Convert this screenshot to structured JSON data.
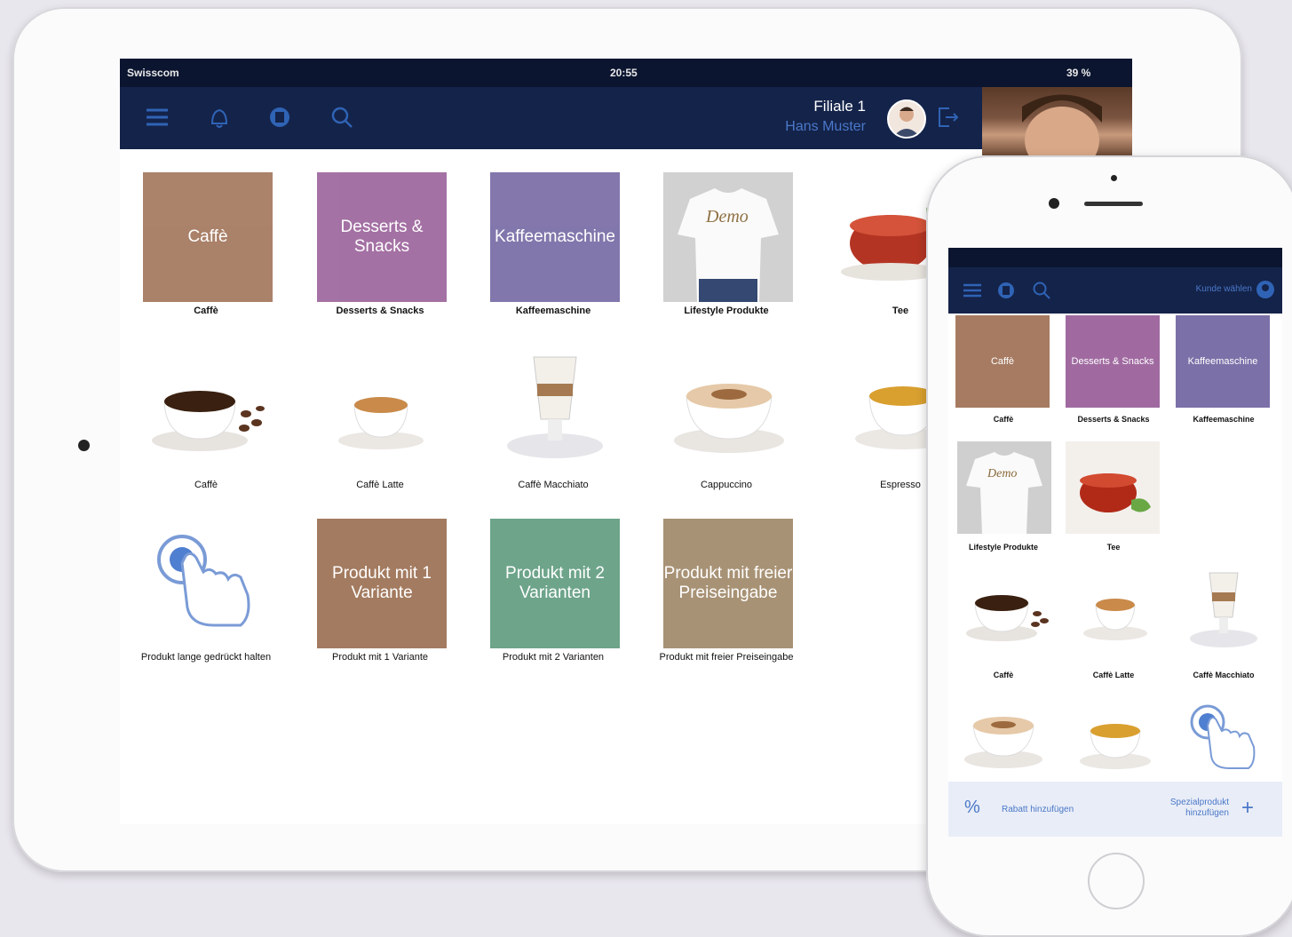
{
  "ipad": {
    "status": {
      "carrier": "Swisscom",
      "time": "20:55",
      "battery": "39 %"
    },
    "header": {
      "branch": "Filiale 1",
      "user": "Hans Muster"
    },
    "tiles": [
      {
        "text": "Caffè",
        "label": "Caffè",
        "color": "#a67b62"
      },
      {
        "text": "Desserts & Snacks",
        "label": "Desserts & Snacks",
        "color": "#a06aa0"
      },
      {
        "text": "Kaffeemaschine",
        "label": "Kaffeemaschine",
        "color": "#7c70a8"
      },
      {
        "text": "",
        "label": "Lifestyle Produkte",
        "color": "#cfcfcf"
      },
      {
        "text": "",
        "label": "Tee",
        "color": "#f3f0ec"
      }
    ],
    "row2": [
      {
        "label": "Caffè"
      },
      {
        "label": "Caffè Latte"
      },
      {
        "label": "Caffè Macchiato"
      },
      {
        "label": "Cappuccino"
      },
      {
        "label": "Espresso"
      }
    ],
    "row3": [
      {
        "label": "Produkt lange gedrückt halten",
        "text": ""
      },
      {
        "label": "Produkt mit     1 Variante",
        "text": "Produkt mit 1 Variante",
        "color": "#9f7458"
      },
      {
        "label": "Produkt mit     2 Varianten",
        "text": "Produkt mit 2 Varianten",
        "color": "#66a084"
      },
      {
        "label": "Produkt mit freier Preiseingabe",
        "text": "Produkt mit freier Preiseingabe",
        "color": "#a48d6e"
      }
    ]
  },
  "iphone": {
    "header": {
      "customer_button": "Kunde wählen"
    },
    "tiles": [
      {
        "text": "Caffè",
        "label": "Caffè",
        "color": "#a67b62"
      },
      {
        "text": "Desserts & Snacks",
        "label": "Desserts & Snacks",
        "color": "#a06aa0"
      },
      {
        "text": "Kaffeemaschine",
        "label": "Kaffeemaschine",
        "color": "#7c70a8"
      },
      {
        "text": "",
        "label": "Lifestyle Produkte",
        "color": "#cfcfcf"
      },
      {
        "text": "",
        "label": "Tee",
        "color": "#f3f0ec"
      }
    ],
    "row3": [
      {
        "label": "Caffè"
      },
      {
        "label": "Caffè Latte"
      },
      {
        "label": "Caffè Macchiato"
      }
    ],
    "bottom": {
      "discount": "Rabatt hinzufügen",
      "special": "Spezialprodukt hinzufügen"
    }
  }
}
